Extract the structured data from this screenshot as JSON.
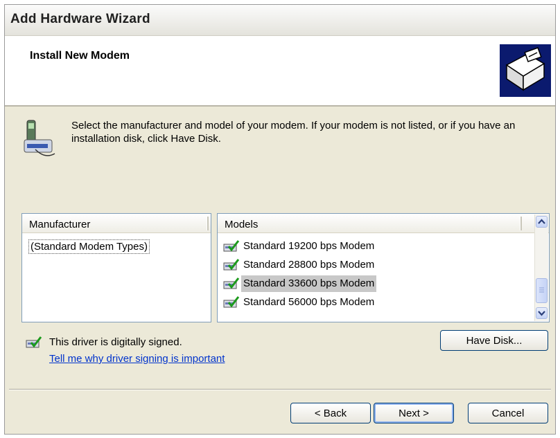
{
  "window": {
    "title": "Add Hardware Wizard"
  },
  "header": {
    "title": "Install New Modem",
    "icon": "hardware-box-icon"
  },
  "instructions": "Select the manufacturer and model of your modem. If your modem is not listed, or if you have an installation disk, click Have Disk.",
  "manufacturer_list": {
    "header": "Manufacturer",
    "items": [
      "(Standard Modem Types)"
    ],
    "selected": "(Standard Modem Types)"
  },
  "models_list": {
    "header": "Models",
    "items": [
      "Standard 19200 bps Modem",
      "Standard 28800 bps Modem",
      "Standard 33600 bps Modem",
      "Standard 56000 bps Modem"
    ],
    "selected": "Standard 33600 bps Modem"
  },
  "signing": {
    "text": "This driver is digitally signed.",
    "link": "Tell me why driver signing is important"
  },
  "buttons": {
    "have_disk": "Have Disk...",
    "back": "< Back",
    "next": "Next >",
    "cancel": "Cancel"
  },
  "colors": {
    "accent": "#003c74",
    "link": "#0033cc",
    "selection": "#c8c8c8"
  }
}
